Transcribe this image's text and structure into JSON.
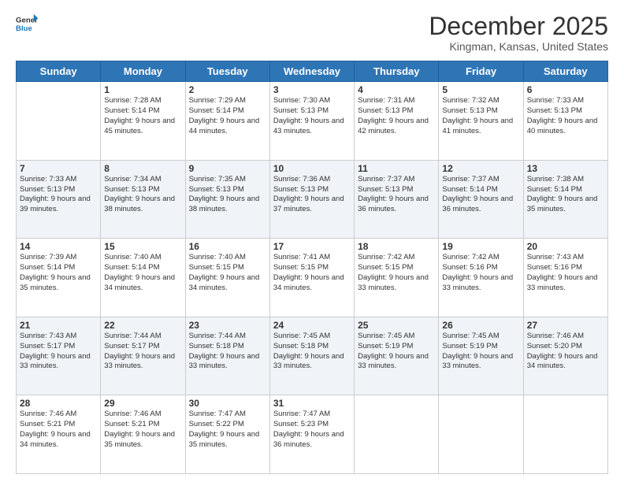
{
  "header": {
    "logo_line1": "General",
    "logo_line2": "Blue",
    "month": "December 2025",
    "location": "Kingman, Kansas, United States"
  },
  "weekdays": [
    "Sunday",
    "Monday",
    "Tuesday",
    "Wednesday",
    "Thursday",
    "Friday",
    "Saturday"
  ],
  "weeks": [
    [
      {
        "day": "",
        "sunrise": "",
        "sunset": "",
        "daylight": ""
      },
      {
        "day": "1",
        "sunrise": "Sunrise: 7:28 AM",
        "sunset": "Sunset: 5:14 PM",
        "daylight": "Daylight: 9 hours and 45 minutes."
      },
      {
        "day": "2",
        "sunrise": "Sunrise: 7:29 AM",
        "sunset": "Sunset: 5:14 PM",
        "daylight": "Daylight: 9 hours and 44 minutes."
      },
      {
        "day": "3",
        "sunrise": "Sunrise: 7:30 AM",
        "sunset": "Sunset: 5:13 PM",
        "daylight": "Daylight: 9 hours and 43 minutes."
      },
      {
        "day": "4",
        "sunrise": "Sunrise: 7:31 AM",
        "sunset": "Sunset: 5:13 PM",
        "daylight": "Daylight: 9 hours and 42 minutes."
      },
      {
        "day": "5",
        "sunrise": "Sunrise: 7:32 AM",
        "sunset": "Sunset: 5:13 PM",
        "daylight": "Daylight: 9 hours and 41 minutes."
      },
      {
        "day": "6",
        "sunrise": "Sunrise: 7:33 AM",
        "sunset": "Sunset: 5:13 PM",
        "daylight": "Daylight: 9 hours and 40 minutes."
      }
    ],
    [
      {
        "day": "7",
        "sunrise": "Sunrise: 7:33 AM",
        "sunset": "Sunset: 5:13 PM",
        "daylight": "Daylight: 9 hours and 39 minutes."
      },
      {
        "day": "8",
        "sunrise": "Sunrise: 7:34 AM",
        "sunset": "Sunset: 5:13 PM",
        "daylight": "Daylight: 9 hours and 38 minutes."
      },
      {
        "day": "9",
        "sunrise": "Sunrise: 7:35 AM",
        "sunset": "Sunset: 5:13 PM",
        "daylight": "Daylight: 9 hours and 38 minutes."
      },
      {
        "day": "10",
        "sunrise": "Sunrise: 7:36 AM",
        "sunset": "Sunset: 5:13 PM",
        "daylight": "Daylight: 9 hours and 37 minutes."
      },
      {
        "day": "11",
        "sunrise": "Sunrise: 7:37 AM",
        "sunset": "Sunset: 5:13 PM",
        "daylight": "Daylight: 9 hours and 36 minutes."
      },
      {
        "day": "12",
        "sunrise": "Sunrise: 7:37 AM",
        "sunset": "Sunset: 5:14 PM",
        "daylight": "Daylight: 9 hours and 36 minutes."
      },
      {
        "day": "13",
        "sunrise": "Sunrise: 7:38 AM",
        "sunset": "Sunset: 5:14 PM",
        "daylight": "Daylight: 9 hours and 35 minutes."
      }
    ],
    [
      {
        "day": "14",
        "sunrise": "Sunrise: 7:39 AM",
        "sunset": "Sunset: 5:14 PM",
        "daylight": "Daylight: 9 hours and 35 minutes."
      },
      {
        "day": "15",
        "sunrise": "Sunrise: 7:40 AM",
        "sunset": "Sunset: 5:14 PM",
        "daylight": "Daylight: 9 hours and 34 minutes."
      },
      {
        "day": "16",
        "sunrise": "Sunrise: 7:40 AM",
        "sunset": "Sunset: 5:15 PM",
        "daylight": "Daylight: 9 hours and 34 minutes."
      },
      {
        "day": "17",
        "sunrise": "Sunrise: 7:41 AM",
        "sunset": "Sunset: 5:15 PM",
        "daylight": "Daylight: 9 hours and 34 minutes."
      },
      {
        "day": "18",
        "sunrise": "Sunrise: 7:42 AM",
        "sunset": "Sunset: 5:15 PM",
        "daylight": "Daylight: 9 hours and 33 minutes."
      },
      {
        "day": "19",
        "sunrise": "Sunrise: 7:42 AM",
        "sunset": "Sunset: 5:16 PM",
        "daylight": "Daylight: 9 hours and 33 minutes."
      },
      {
        "day": "20",
        "sunrise": "Sunrise: 7:43 AM",
        "sunset": "Sunset: 5:16 PM",
        "daylight": "Daylight: 9 hours and 33 minutes."
      }
    ],
    [
      {
        "day": "21",
        "sunrise": "Sunrise: 7:43 AM",
        "sunset": "Sunset: 5:17 PM",
        "daylight": "Daylight: 9 hours and 33 minutes."
      },
      {
        "day": "22",
        "sunrise": "Sunrise: 7:44 AM",
        "sunset": "Sunset: 5:17 PM",
        "daylight": "Daylight: 9 hours and 33 minutes."
      },
      {
        "day": "23",
        "sunrise": "Sunrise: 7:44 AM",
        "sunset": "Sunset: 5:18 PM",
        "daylight": "Daylight: 9 hours and 33 minutes."
      },
      {
        "day": "24",
        "sunrise": "Sunrise: 7:45 AM",
        "sunset": "Sunset: 5:18 PM",
        "daylight": "Daylight: 9 hours and 33 minutes."
      },
      {
        "day": "25",
        "sunrise": "Sunrise: 7:45 AM",
        "sunset": "Sunset: 5:19 PM",
        "daylight": "Daylight: 9 hours and 33 minutes."
      },
      {
        "day": "26",
        "sunrise": "Sunrise: 7:45 AM",
        "sunset": "Sunset: 5:19 PM",
        "daylight": "Daylight: 9 hours and 33 minutes."
      },
      {
        "day": "27",
        "sunrise": "Sunrise: 7:46 AM",
        "sunset": "Sunset: 5:20 PM",
        "daylight": "Daylight: 9 hours and 34 minutes."
      }
    ],
    [
      {
        "day": "28",
        "sunrise": "Sunrise: 7:46 AM",
        "sunset": "Sunset: 5:21 PM",
        "daylight": "Daylight: 9 hours and 34 minutes."
      },
      {
        "day": "29",
        "sunrise": "Sunrise: 7:46 AM",
        "sunset": "Sunset: 5:21 PM",
        "daylight": "Daylight: 9 hours and 35 minutes."
      },
      {
        "day": "30",
        "sunrise": "Sunrise: 7:47 AM",
        "sunset": "Sunset: 5:22 PM",
        "daylight": "Daylight: 9 hours and 35 minutes."
      },
      {
        "day": "31",
        "sunrise": "Sunrise: 7:47 AM",
        "sunset": "Sunset: 5:23 PM",
        "daylight": "Daylight: 9 hours and 36 minutes."
      },
      {
        "day": "",
        "sunrise": "",
        "sunset": "",
        "daylight": ""
      },
      {
        "day": "",
        "sunrise": "",
        "sunset": "",
        "daylight": ""
      },
      {
        "day": "",
        "sunrise": "",
        "sunset": "",
        "daylight": ""
      }
    ]
  ]
}
